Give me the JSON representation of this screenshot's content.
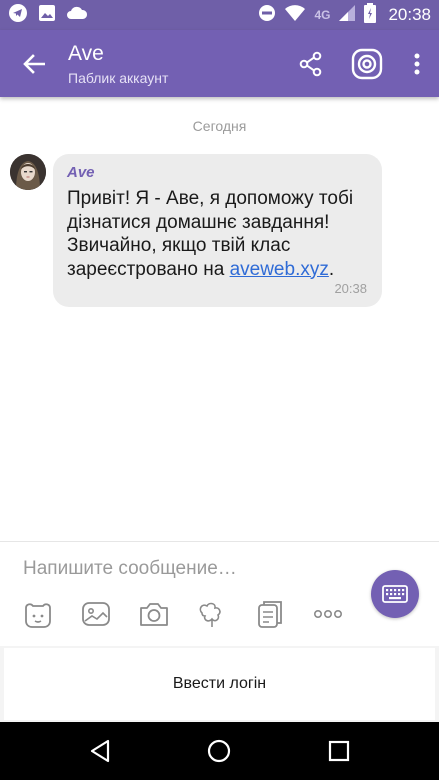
{
  "status_bar": {
    "time": "20:38",
    "network": "4G",
    "left_icons": [
      "telegram-icon",
      "image-icon",
      "cloud-icon"
    ],
    "right_icons": [
      "dnd-icon",
      "wifi-icon",
      "signal-icon",
      "battery-icon"
    ]
  },
  "header": {
    "title": "Ave",
    "subtitle": "Паблик аккаунт",
    "actions": [
      "share-icon",
      "viber-icon",
      "more-icon"
    ]
  },
  "chat": {
    "date_separator": "Сегодня",
    "messages": [
      {
        "sender": "Ave",
        "text_before_link": "Привіт! Я - Аве, я допоможу тобі дізнатися домашнє завдання! Звичайно, якщо твій клас зареєстровано на ",
        "link": "aveweb.xyz",
        "text_after_link": ".",
        "time": "20:38"
      }
    ]
  },
  "composer": {
    "placeholder": "Напишите сообщение…",
    "tools": [
      "sticker-icon",
      "gallery-icon",
      "camera-icon",
      "doodle-icon",
      "gif-icon",
      "more-options-icon"
    ]
  },
  "keyboard_button": {
    "icon": "keyboard-icon"
  },
  "login_button": {
    "label": "Ввести логін"
  },
  "colors": {
    "accent": "#7360b3",
    "status_bar": "#6f5fa8",
    "bubble": "#ececec",
    "link": "#2f6bd6"
  }
}
